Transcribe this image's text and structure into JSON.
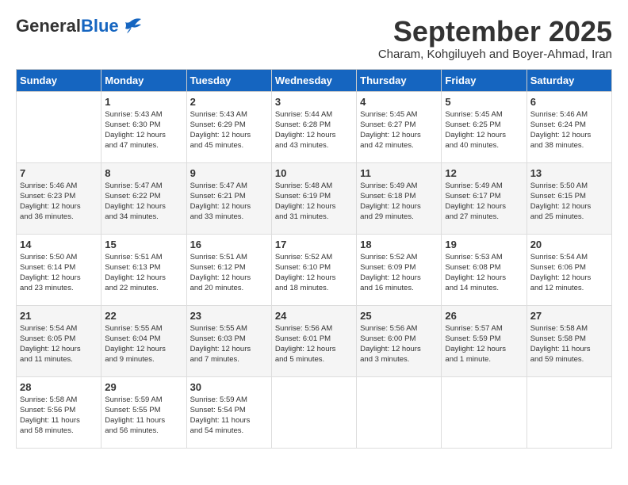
{
  "header": {
    "logo_general": "General",
    "logo_blue": "Blue",
    "month_title": "September 2025",
    "subtitle": "Charam, Kohgiluyeh and Boyer-Ahmad, Iran"
  },
  "weekdays": [
    "Sunday",
    "Monday",
    "Tuesday",
    "Wednesday",
    "Thursday",
    "Friday",
    "Saturday"
  ],
  "weeks": [
    [
      {
        "day": "",
        "info": ""
      },
      {
        "day": "1",
        "info": "Sunrise: 5:43 AM\nSunset: 6:30 PM\nDaylight: 12 hours\nand 47 minutes."
      },
      {
        "day": "2",
        "info": "Sunrise: 5:43 AM\nSunset: 6:29 PM\nDaylight: 12 hours\nand 45 minutes."
      },
      {
        "day": "3",
        "info": "Sunrise: 5:44 AM\nSunset: 6:28 PM\nDaylight: 12 hours\nand 43 minutes."
      },
      {
        "day": "4",
        "info": "Sunrise: 5:45 AM\nSunset: 6:27 PM\nDaylight: 12 hours\nand 42 minutes."
      },
      {
        "day": "5",
        "info": "Sunrise: 5:45 AM\nSunset: 6:25 PM\nDaylight: 12 hours\nand 40 minutes."
      },
      {
        "day": "6",
        "info": "Sunrise: 5:46 AM\nSunset: 6:24 PM\nDaylight: 12 hours\nand 38 minutes."
      }
    ],
    [
      {
        "day": "7",
        "info": "Sunrise: 5:46 AM\nSunset: 6:23 PM\nDaylight: 12 hours\nand 36 minutes."
      },
      {
        "day": "8",
        "info": "Sunrise: 5:47 AM\nSunset: 6:22 PM\nDaylight: 12 hours\nand 34 minutes."
      },
      {
        "day": "9",
        "info": "Sunrise: 5:47 AM\nSunset: 6:21 PM\nDaylight: 12 hours\nand 33 minutes."
      },
      {
        "day": "10",
        "info": "Sunrise: 5:48 AM\nSunset: 6:19 PM\nDaylight: 12 hours\nand 31 minutes."
      },
      {
        "day": "11",
        "info": "Sunrise: 5:49 AM\nSunset: 6:18 PM\nDaylight: 12 hours\nand 29 minutes."
      },
      {
        "day": "12",
        "info": "Sunrise: 5:49 AM\nSunset: 6:17 PM\nDaylight: 12 hours\nand 27 minutes."
      },
      {
        "day": "13",
        "info": "Sunrise: 5:50 AM\nSunset: 6:15 PM\nDaylight: 12 hours\nand 25 minutes."
      }
    ],
    [
      {
        "day": "14",
        "info": "Sunrise: 5:50 AM\nSunset: 6:14 PM\nDaylight: 12 hours\nand 23 minutes."
      },
      {
        "day": "15",
        "info": "Sunrise: 5:51 AM\nSunset: 6:13 PM\nDaylight: 12 hours\nand 22 minutes."
      },
      {
        "day": "16",
        "info": "Sunrise: 5:51 AM\nSunset: 6:12 PM\nDaylight: 12 hours\nand 20 minutes."
      },
      {
        "day": "17",
        "info": "Sunrise: 5:52 AM\nSunset: 6:10 PM\nDaylight: 12 hours\nand 18 minutes."
      },
      {
        "day": "18",
        "info": "Sunrise: 5:52 AM\nSunset: 6:09 PM\nDaylight: 12 hours\nand 16 minutes."
      },
      {
        "day": "19",
        "info": "Sunrise: 5:53 AM\nSunset: 6:08 PM\nDaylight: 12 hours\nand 14 minutes."
      },
      {
        "day": "20",
        "info": "Sunrise: 5:54 AM\nSunset: 6:06 PM\nDaylight: 12 hours\nand 12 minutes."
      }
    ],
    [
      {
        "day": "21",
        "info": "Sunrise: 5:54 AM\nSunset: 6:05 PM\nDaylight: 12 hours\nand 11 minutes."
      },
      {
        "day": "22",
        "info": "Sunrise: 5:55 AM\nSunset: 6:04 PM\nDaylight: 12 hours\nand 9 minutes."
      },
      {
        "day": "23",
        "info": "Sunrise: 5:55 AM\nSunset: 6:03 PM\nDaylight: 12 hours\nand 7 minutes."
      },
      {
        "day": "24",
        "info": "Sunrise: 5:56 AM\nSunset: 6:01 PM\nDaylight: 12 hours\nand 5 minutes."
      },
      {
        "day": "25",
        "info": "Sunrise: 5:56 AM\nSunset: 6:00 PM\nDaylight: 12 hours\nand 3 minutes."
      },
      {
        "day": "26",
        "info": "Sunrise: 5:57 AM\nSunset: 5:59 PM\nDaylight: 12 hours\nand 1 minute."
      },
      {
        "day": "27",
        "info": "Sunrise: 5:58 AM\nSunset: 5:58 PM\nDaylight: 11 hours\nand 59 minutes."
      }
    ],
    [
      {
        "day": "28",
        "info": "Sunrise: 5:58 AM\nSunset: 5:56 PM\nDaylight: 11 hours\nand 58 minutes."
      },
      {
        "day": "29",
        "info": "Sunrise: 5:59 AM\nSunset: 5:55 PM\nDaylight: 11 hours\nand 56 minutes."
      },
      {
        "day": "30",
        "info": "Sunrise: 5:59 AM\nSunset: 5:54 PM\nDaylight: 11 hours\nand 54 minutes."
      },
      {
        "day": "",
        "info": ""
      },
      {
        "day": "",
        "info": ""
      },
      {
        "day": "",
        "info": ""
      },
      {
        "day": "",
        "info": ""
      }
    ]
  ]
}
